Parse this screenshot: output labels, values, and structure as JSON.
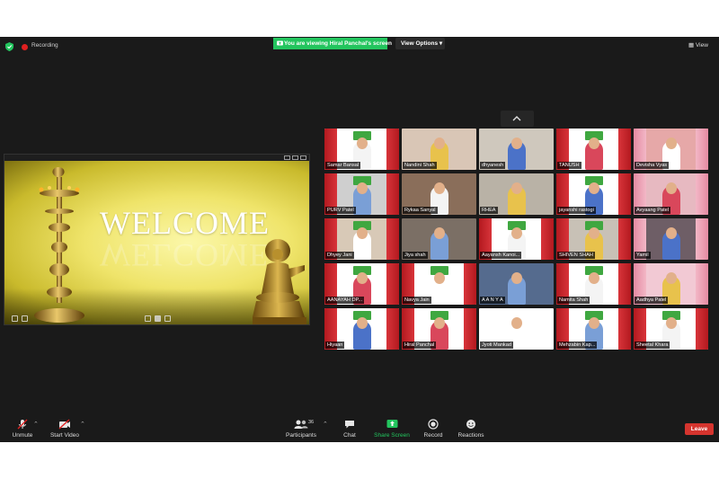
{
  "topbar": {
    "recording_label": "Recording",
    "share_banner": "You are viewing Hiral Panchal's screen",
    "view_options": "View Options",
    "view_label": "View"
  },
  "shared_screen": {
    "slide_title": "WELCOME"
  },
  "participants": [
    {
      "name": "Samar Bansal",
      "bg": "#ffffff",
      "style": "curtain"
    },
    {
      "name": "Nandini Shah",
      "bg": "#d9c6b6",
      "style": "home"
    },
    {
      "name": "dhyanesh",
      "bg": "#cfc8bd",
      "style": "home"
    },
    {
      "name": "TANUSH",
      "bg": "#ffffff",
      "style": "curtain"
    },
    {
      "name": "Devisha Vyas",
      "bg": "#e6a8a8",
      "style": "pink"
    },
    {
      "name": "PURV Patel",
      "bg": "#cfcfcf",
      "style": "curtain"
    },
    {
      "name": "Rykaa Sanyal",
      "bg": "#8a6e5a",
      "style": "home"
    },
    {
      "name": "RHEA",
      "bg": "#b9b2a6",
      "style": "home"
    },
    {
      "name": "jayanshi rastogi",
      "bg": "#ffffff",
      "style": "curtain"
    },
    {
      "name": "Avyaang Patel",
      "bg": "#e7b9c1",
      "style": "pink"
    },
    {
      "name": "Dhyey Jani",
      "bg": "#d8c9b7",
      "style": "curtain"
    },
    {
      "name": "Jiya shah",
      "bg": "#7b6f65",
      "style": "home"
    },
    {
      "name": "Aayansh Kanoi...",
      "bg": "#ffffff",
      "style": "curtain"
    },
    {
      "name": "SHIVEN SHAH",
      "bg": "#c8c1b6",
      "style": "curtain"
    },
    {
      "name": "Yamil",
      "bg": "#6e5e66",
      "style": "pink"
    },
    {
      "name": "AANAYAH DP...",
      "bg": "#ffffff",
      "style": "curtain"
    },
    {
      "name": "Navya Jain",
      "bg": "#ffffff",
      "style": "curtain"
    },
    {
      "name": "A A N Y A",
      "bg": "#556b8e",
      "style": "home"
    },
    {
      "name": "Namita Shah",
      "bg": "#ffffff",
      "style": "curtain"
    },
    {
      "name": "Aadhya Patel",
      "bg": "#f2c9d4",
      "style": "pink"
    },
    {
      "name": "Hiyaan",
      "bg": "#ffffff",
      "style": "curtain"
    },
    {
      "name": "Hiral Panchal",
      "bg": "#ffffff",
      "style": "curtain"
    },
    {
      "name": "Jyoti Mankad",
      "bg": "#ffffff",
      "style": "photo"
    },
    {
      "name": "Mehzabin Kap...",
      "bg": "#ffffff",
      "style": "curtain"
    },
    {
      "name": "Sheetal Khara",
      "bg": "#ffffff",
      "style": "curtain"
    }
  ],
  "toolbar": {
    "unmute": "Unmute",
    "start_video": "Start Video",
    "participants": "Participants",
    "participant_count": "36",
    "chat": "Chat",
    "share_screen": "Share Screen",
    "record": "Record",
    "reactions": "Reactions",
    "leave": "Leave"
  },
  "colors": {
    "app_bg": "#1a1a1a",
    "share_green": "#23c55e",
    "leave_red": "#d5342e"
  }
}
